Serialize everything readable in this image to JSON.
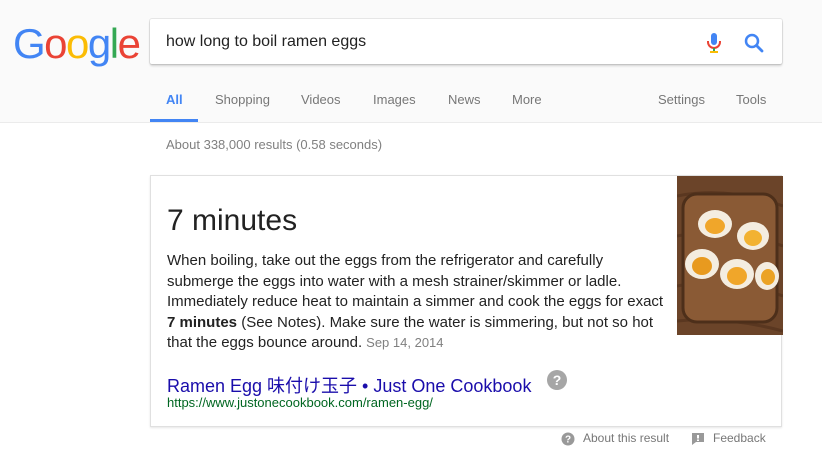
{
  "logo": {
    "letters": [
      {
        "char": "G",
        "color": "#4285F4"
      },
      {
        "char": "o",
        "color": "#EA4335"
      },
      {
        "char": "o",
        "color": "#FBBC05"
      },
      {
        "char": "g",
        "color": "#4285F4"
      },
      {
        "char": "l",
        "color": "#34A853"
      },
      {
        "char": "e",
        "color": "#EA4335"
      }
    ]
  },
  "search": {
    "query": "how long to boil ramen eggs",
    "mic_icon": "microphone-icon",
    "search_icon": "magnifier-icon"
  },
  "tabs": [
    {
      "label": "All",
      "active": true
    },
    {
      "label": "Shopping"
    },
    {
      "label": "Videos"
    },
    {
      "label": "Images"
    },
    {
      "label": "News"
    },
    {
      "label": "More"
    },
    {
      "label": "Settings"
    },
    {
      "label": "Tools"
    }
  ],
  "results_count": "About 338,000 results (0.58 seconds)",
  "featured_snippet": {
    "answer": "7 minutes",
    "text_before": "When boiling, take out the eggs from the refrigerator and carefully submerge the eggs into water with a mesh strainer/skimmer or ladle. Immediately reduce heat to maintain a simmer and cook the eggs for exact ",
    "text_bold": "7 minutes",
    "text_after": " (See Notes). Make sure the water is simmering, but not so hot that the eggs bounce around.",
    "date": "Sep 14, 2014",
    "source_title": "Ramen Egg 味付け玉子 • Just One Cookbook",
    "source_url": "https://www.justonecookbook.com/ramen-egg/"
  },
  "footer": {
    "about_label": "About this result",
    "feedback_label": "Feedback"
  },
  "colors": {
    "accent": "#4285f4",
    "link": "#1a0dab",
    "url": "#006621"
  }
}
